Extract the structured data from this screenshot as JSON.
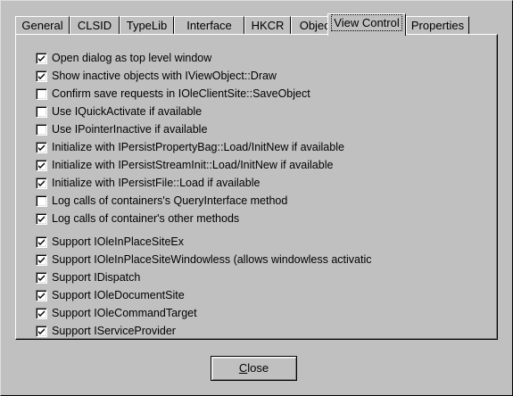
{
  "tabs": [
    {
      "label": "General",
      "active": false
    },
    {
      "label": "CLSID",
      "active": false
    },
    {
      "label": "TypeLib",
      "active": false
    },
    {
      "label": "Interface",
      "active": false
    },
    {
      "label": "HKCR",
      "active": false
    },
    {
      "label": "Object",
      "active": false
    },
    {
      "label": "View Control",
      "active": true
    },
    {
      "label": "Properties",
      "active": false
    }
  ],
  "options": [
    {
      "label": "Open dialog as top level window",
      "checked": true
    },
    {
      "label": "Show inactive objects with IViewObject::Draw",
      "checked": true
    },
    {
      "label": "Confirm save requests in IOleClientSite::SaveObject",
      "checked": false
    },
    {
      "label": "Use IQuickActivate if available",
      "checked": false
    },
    {
      "label": "Use IPointerInactive if available",
      "checked": false
    },
    {
      "label": "Initialize with IPersistPropertyBag::Load/InitNew if available",
      "checked": true
    },
    {
      "label": "Initialize with IPersistStreamInit::Load/InitNew if available",
      "checked": true
    },
    {
      "label": "Initialize with IPersistFile::Load if available",
      "checked": true
    },
    {
      "label": "Log calls of containers's QueryInterface method",
      "checked": false
    },
    {
      "label": "Log calls of container's other methods",
      "checked": true
    },
    {
      "label": "Support IOleInPlaceSiteEx",
      "checked": true
    },
    {
      "label": "Support IOleInPlaceSiteWindowless (allows windowless activatic",
      "checked": true
    },
    {
      "label": "Support IDispatch",
      "checked": true
    },
    {
      "label": "Support IOleDocumentSite",
      "checked": true
    },
    {
      "label": "Support IOleCommandTarget",
      "checked": true
    },
    {
      "label": "Support IServiceProvider",
      "checked": true
    }
  ],
  "buttons": {
    "close_mnemonic": "C",
    "close_rest": "lose"
  }
}
